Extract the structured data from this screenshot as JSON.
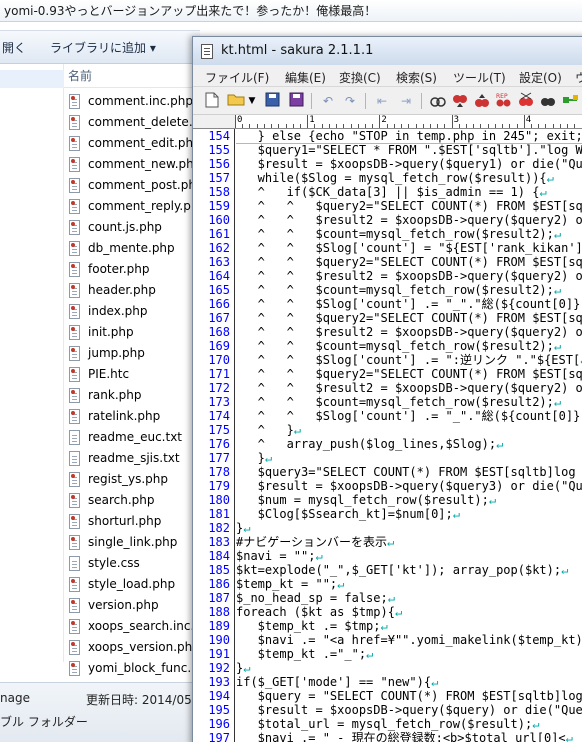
{
  "top_title": "yomi-0.93やっとバージョンアップ出来たで！参ったか！俺様最高！",
  "explorer": {
    "toolbar": {
      "left_fragment": "開く",
      "library_button": "ライブラリに追加 ▾"
    },
    "column_header": "名前",
    "files": [
      {
        "name": "comment.inc.php",
        "type": "php"
      },
      {
        "name": "comment_delete.",
        "type": "php"
      },
      {
        "name": "comment_edit.ph",
        "type": "php"
      },
      {
        "name": "comment_new.ph",
        "type": "php"
      },
      {
        "name": "comment_post.ph",
        "type": "php"
      },
      {
        "name": "comment_reply.p",
        "type": "php"
      },
      {
        "name": "count.js.php",
        "type": "php"
      },
      {
        "name": "db_mente.php",
        "type": "php"
      },
      {
        "name": "footer.php",
        "type": "php"
      },
      {
        "name": "header.php",
        "type": "php"
      },
      {
        "name": "index.php",
        "type": "php"
      },
      {
        "name": "init.php",
        "type": "php"
      },
      {
        "name": "jump.php",
        "type": "php"
      },
      {
        "name": "PIE.htc",
        "type": "php"
      },
      {
        "name": "rank.php",
        "type": "php"
      },
      {
        "name": "ratelink.php",
        "type": "php"
      },
      {
        "name": "readme_euc.txt",
        "type": "txt"
      },
      {
        "name": "readme_sjis.txt",
        "type": "txt"
      },
      {
        "name": "regist_ys.php",
        "type": "php"
      },
      {
        "name": "search.php",
        "type": "php"
      },
      {
        "name": "shorturl.php",
        "type": "php"
      },
      {
        "name": "single_link.php",
        "type": "php"
      },
      {
        "name": "style.css",
        "type": "txt"
      },
      {
        "name": "style_load.php",
        "type": "php"
      },
      {
        "name": "version.php",
        "type": "php"
      },
      {
        "name": "xoops_search.inc.",
        "type": "php"
      },
      {
        "name": "xoops_version.ph",
        "type": "php"
      },
      {
        "name": "yomi_block_func.",
        "type": "php"
      }
    ],
    "status": {
      "left_top": "nage",
      "left_bottom": "ブル フォルダー",
      "updated": "更新日時: 2014/05"
    }
  },
  "editor": {
    "title": "kt.html - sakura 2.1.1.1",
    "menu": [
      "ファイル(F)",
      "編集(E)",
      "変換(C)",
      "検索(S)",
      "ツール(T)",
      "設定(O)",
      "ウ"
    ],
    "ruler_labels": [
      "0",
      "1",
      "2",
      "3",
      "4"
    ],
    "lines": [
      {
        "n": "154",
        "t": "   } else {echo \"STOP in temp.php in 245\"; exit;}"
      },
      {
        "n": "155",
        "t": "   $query1=\"SELECT * FROM \".$EST['sqltb'].\"log WH"
      },
      {
        "n": "156",
        "t": "   $result = $xoopsDB->query($query1) or die(\"Que"
      },
      {
        "n": "157",
        "t": "   while($Slog = mysql_fetch_row($result)){"
      },
      {
        "n": "158",
        "t": "   ^   if($CK_data[3] || $is_admin == 1) {"
      },
      {
        "n": "159",
        "t": "   ^   ^   $query2=\"SELECT COUNT(*) FROM $EST[sql"
      },
      {
        "n": "160",
        "t": "   ^   ^   $result2 = $xoopsDB->query($query2) or"
      },
      {
        "n": "161",
        "t": "   ^   ^   $count=mysql_fetch_row($result2);"
      },
      {
        "n": "162",
        "t": "   ^   ^   $Slog['count'] = \"${EST['rank_kikan']}"
      },
      {
        "n": "163",
        "t": "   ^   ^   $query2=\"SELECT COUNT(*) FROM $EST[sql"
      },
      {
        "n": "164",
        "t": "   ^   ^   $result2 = $xoopsDB->query($query2) or"
      },
      {
        "n": "165",
        "t": "   ^   ^   $count=mysql_fetch_row($result2);"
      },
      {
        "n": "166",
        "t": "   ^   ^   $Slog['count'] .= \"_\".\"総(${count[0]})"
      },
      {
        "n": "167",
        "t": "   ^   ^   $query2=\"SELECT COUNT(*) FROM $EST[sql"
      },
      {
        "n": "168",
        "t": "   ^   ^   $result2 = $xoopsDB->query($query2) or"
      },
      {
        "n": "169",
        "t": "   ^   ^   $count=mysql_fetch_row($result2);"
      },
      {
        "n": "170",
        "t": "   ^   ^   $Slog['count'] .= \":逆リンク \".\"${EST["
      },
      {
        "n": "171",
        "t": "   ^   ^   $query2=\"SELECT COUNT(*) FROM $EST[sql"
      },
      {
        "n": "172",
        "t": "   ^   ^   $result2 = $xoopsDB->query($query2) or"
      },
      {
        "n": "173",
        "t": "   ^   ^   $count=mysql_fetch_row($result2);"
      },
      {
        "n": "174",
        "t": "   ^   ^   $Slog['count'] .= \"_\".\"総(${count[0]})"
      },
      {
        "n": "175",
        "t": "   ^   }"
      },
      {
        "n": "176",
        "t": "   ^   array_push($log_lines,$Slog);"
      },
      {
        "n": "177",
        "t": "   }"
      },
      {
        "n": "178",
        "t": "   $query3=\"SELECT COUNT(*) FROM $EST[sqltb]log W"
      },
      {
        "n": "179",
        "t": "   $result = $xoopsDB->query($query3) or die(\"Que"
      },
      {
        "n": "180",
        "t": "   $num = mysql_fetch_row($result);"
      },
      {
        "n": "181",
        "t": "   $Clog[$Ssearch_kt]=$num[0];"
      },
      {
        "n": "182",
        "t": "}"
      },
      {
        "n": "183",
        "t": "#ナビゲーションバーを表示"
      },
      {
        "n": "184",
        "t": "$navi = \"\";"
      },
      {
        "n": "185",
        "t": "$kt=explode(\"_\",$_GET['kt']); array_pop($kt);"
      },
      {
        "n": "186",
        "t": "$temp_kt = \"\";"
      },
      {
        "n": "187",
        "t": "$_no_head_sp = false;"
      },
      {
        "n": "188",
        "t": "foreach ($kt as $tmp){"
      },
      {
        "n": "189",
        "t": "   $temp_kt .= $tmp;"
      },
      {
        "n": "190",
        "t": "   $navi .= \"<a href=¥\"\".yomi_makelink($temp_kt)."
      },
      {
        "n": "191",
        "t": "   $temp_kt .=\"_\";"
      },
      {
        "n": "192",
        "t": "}"
      },
      {
        "n": "193",
        "t": "if($_GET['mode'] == \"new\"){"
      },
      {
        "n": "194",
        "t": "   $query = \"SELECT COUNT(*) FROM $EST[sqltb]log\""
      },
      {
        "n": "195",
        "t": "   $result = $xoopsDB->query($query) or die(\"Quer"
      },
      {
        "n": "196",
        "t": "   $total_url = mysql_fetch_row($result);"
      },
      {
        "n": "197",
        "t": "   $navi .= \" - 現在の総登録数:<b>$total_url[0]<"
      }
    ]
  }
}
